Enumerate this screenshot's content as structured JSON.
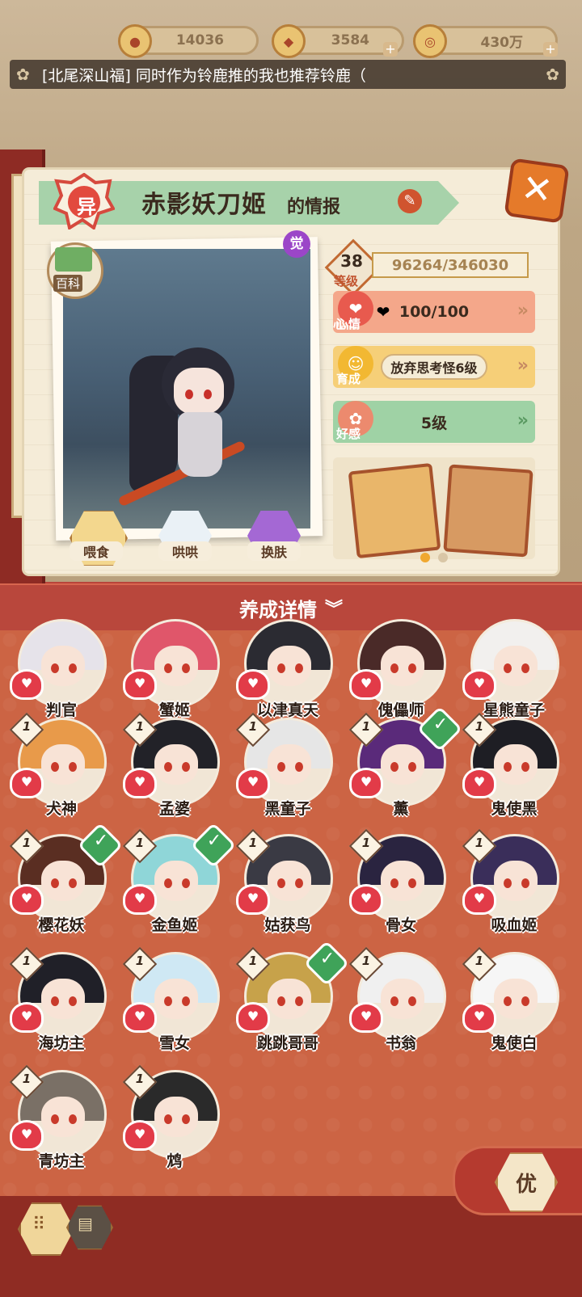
{
  "resources": [
    {
      "name": "currency-1",
      "value": "14036",
      "icon": "coin-icon"
    },
    {
      "name": "currency-2",
      "value": "3584",
      "icon": "jade-icon"
    },
    {
      "name": "currency-3",
      "value": "430万",
      "icon": "gold-icon"
    }
  ],
  "ticker": {
    "text": "[北尾深山福] 同时作为铃鹿推的我也推荐铃鹿（"
  },
  "card": {
    "rarity": "异",
    "title_name": "赤影妖刀姬",
    "title_suffix": "的情报",
    "awaken": "觉",
    "baike": "百科",
    "actions": [
      {
        "label": "喂食"
      },
      {
        "label": "哄哄"
      },
      {
        "label": "换肤"
      }
    ],
    "level": "38",
    "level_label": "等级",
    "exp": "96264/346030",
    "mood_label": "心情",
    "mood_value": "100/100",
    "grow_label": "育成",
    "grow_value": "放弃思考怪6级",
    "favor_label": "好感",
    "favor_value": "5级"
  },
  "nurture": {
    "label": "养成详情"
  },
  "characters": [
    {
      "name": "判官",
      "level": "",
      "checked": false,
      "hair": "#e6e3ea"
    },
    {
      "name": "蟹姬",
      "level": "",
      "checked": false,
      "hair": "#e0566a"
    },
    {
      "name": "以津真天",
      "level": "",
      "checked": false,
      "hair": "#2b2b32"
    },
    {
      "name": "傀儡师",
      "level": "",
      "checked": false,
      "hair": "#4a2a28"
    },
    {
      "name": "星熊童子",
      "level": "",
      "checked": false,
      "hair": "#f2f0ee"
    },
    {
      "name": "犬神",
      "level": "1",
      "checked": false,
      "hair": "#e89a4a"
    },
    {
      "name": "孟婆",
      "level": "1",
      "checked": false,
      "hair": "#222228"
    },
    {
      "name": "黑童子",
      "level": "1",
      "checked": false,
      "hair": "#e6e6e6"
    },
    {
      "name": "薰",
      "level": "1",
      "checked": true,
      "hair": "#5a2a7a"
    },
    {
      "name": "鬼使黑",
      "level": "1",
      "checked": false,
      "hair": "#1e1e24"
    },
    {
      "name": "樱花妖",
      "level": "1",
      "checked": true,
      "hair": "#5a2e22"
    },
    {
      "name": "金鱼姬",
      "level": "1",
      "checked": true,
      "hair": "#8fd6d8"
    },
    {
      "name": "姑获鸟",
      "level": "1",
      "checked": false,
      "hair": "#3a3a44"
    },
    {
      "name": "骨女",
      "level": "1",
      "checked": false,
      "hair": "#2a2440"
    },
    {
      "name": "吸血姬",
      "level": "1",
      "checked": false,
      "hair": "#3a2e5a"
    },
    {
      "name": "海坊主",
      "level": "1",
      "checked": false,
      "hair": "#202028"
    },
    {
      "name": "雪女",
      "level": "1",
      "checked": false,
      "hair": "#cfe8f4"
    },
    {
      "name": "跳跳哥哥",
      "level": "1",
      "checked": true,
      "hair": "#c7a24a"
    },
    {
      "name": "书翁",
      "level": "1",
      "checked": false,
      "hair": "#f0f0f0"
    },
    {
      "name": "鬼使白",
      "level": "1",
      "checked": false,
      "hair": "#f6f6f6"
    },
    {
      "name": "青坊主",
      "level": "1",
      "checked": false,
      "hair": "#7a7066"
    },
    {
      "name": "鸩",
      "level": "1",
      "checked": false,
      "hair": "#2a2a2a"
    }
  ],
  "footer": {
    "you_label": "优"
  },
  "colors": {
    "accent": "#cc6444",
    "header": "#b9473c",
    "check": "#3fa359"
  }
}
